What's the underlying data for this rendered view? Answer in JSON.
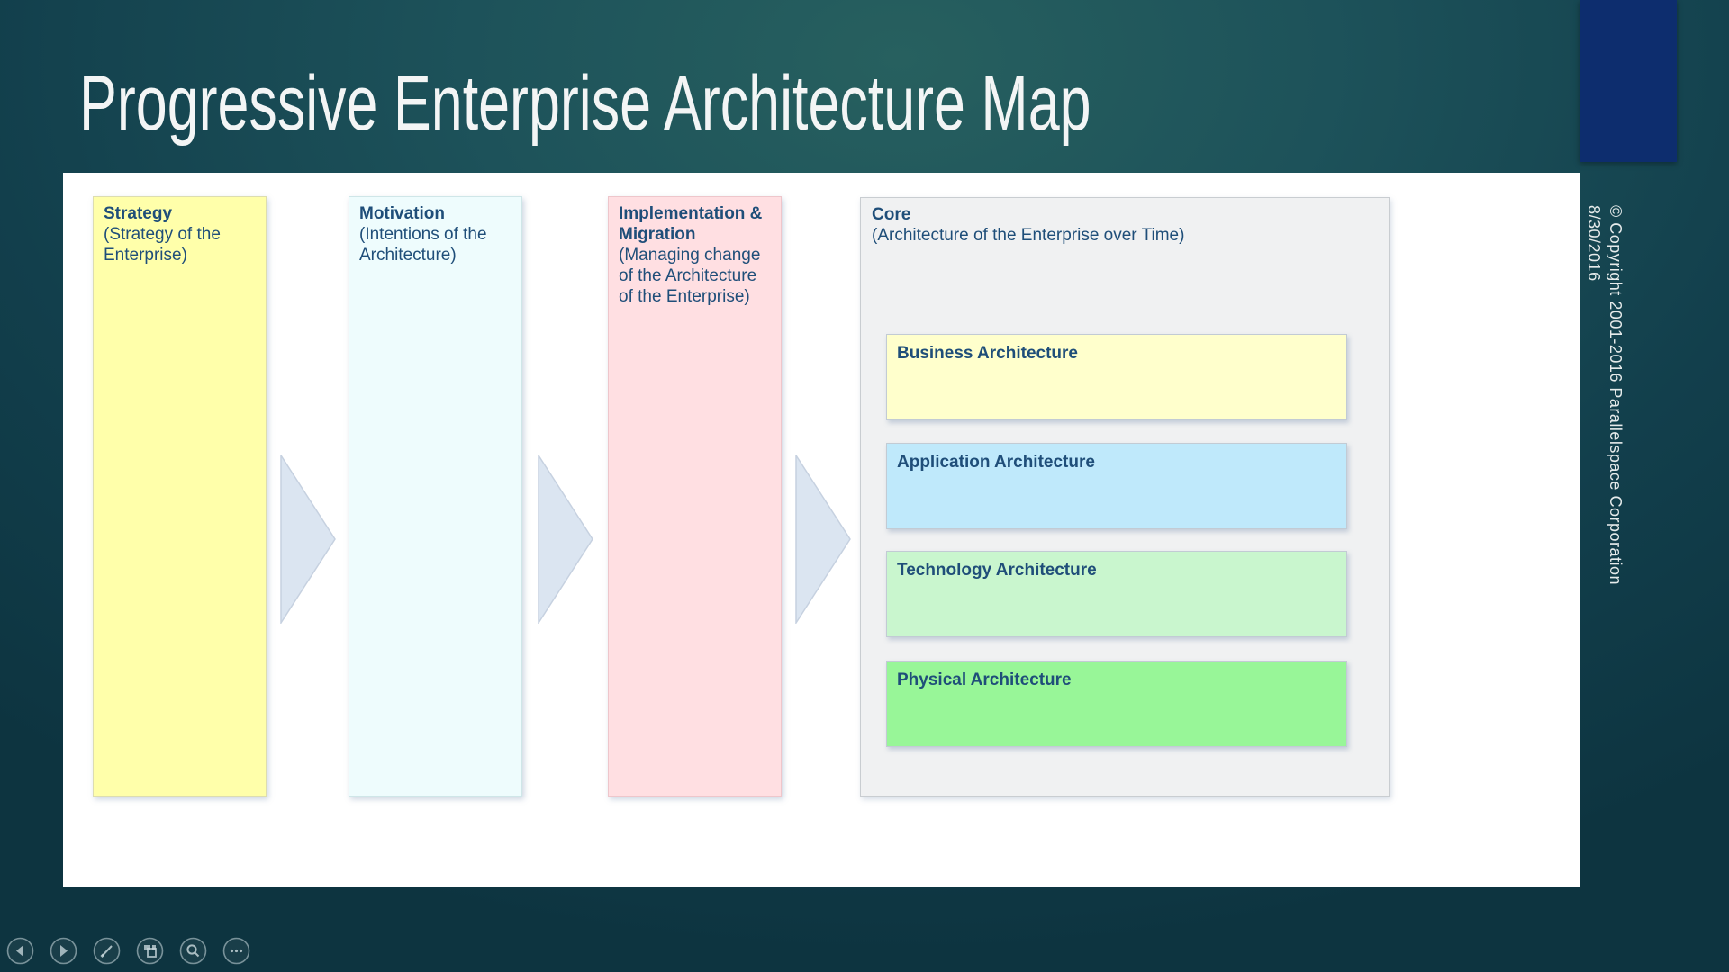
{
  "slide": {
    "title": "Progressive Enterprise Architecture Map",
    "vertical_caption_line1": "© Copyright 2001-2016 Parallelspace Corporation",
    "vertical_caption_line2": "8/30/2016"
  },
  "columns": [
    {
      "title": "Strategy",
      "subtitle": "(Strategy of the Enterprise)",
      "bg": "#ffffaa"
    },
    {
      "title": "Motivation",
      "subtitle": "(Intentions of the Architecture)",
      "bg": "#eefcfd"
    },
    {
      "title": "Implementation & Migration",
      "subtitle": "(Managing change of the Architecture of the Enterprise)",
      "bg": "#ffdfe2"
    }
  ],
  "core": {
    "title": "Core",
    "subtitle": "(Architecture of the Enterprise over Time)",
    "bg": "#f0f1f2",
    "layers": [
      {
        "label": "Business Architecture",
        "bg": "#ffffcc"
      },
      {
        "label": "Application Architecture",
        "bg": "#bfe9fb"
      },
      {
        "label": "Technology Architecture",
        "bg": "#c9f6ce"
      },
      {
        "label": "Physical Architecture",
        "bg": "#98f698"
      }
    ]
  },
  "nav_controls": [
    {
      "name": "previous-slide"
    },
    {
      "name": "next-slide"
    },
    {
      "name": "pen-tools"
    },
    {
      "name": "see-all-slides"
    },
    {
      "name": "zoom-into-slide"
    },
    {
      "name": "more-options"
    }
  ],
  "colors": {
    "background_teal": "#123f4c",
    "accent_navy": "#0d2d6e",
    "canvas_white": "#ffffff",
    "diagram_text_blue": "#1f4e79",
    "arrow_fill": "#dbe5f1",
    "title_text": "#f3f5f5"
  }
}
